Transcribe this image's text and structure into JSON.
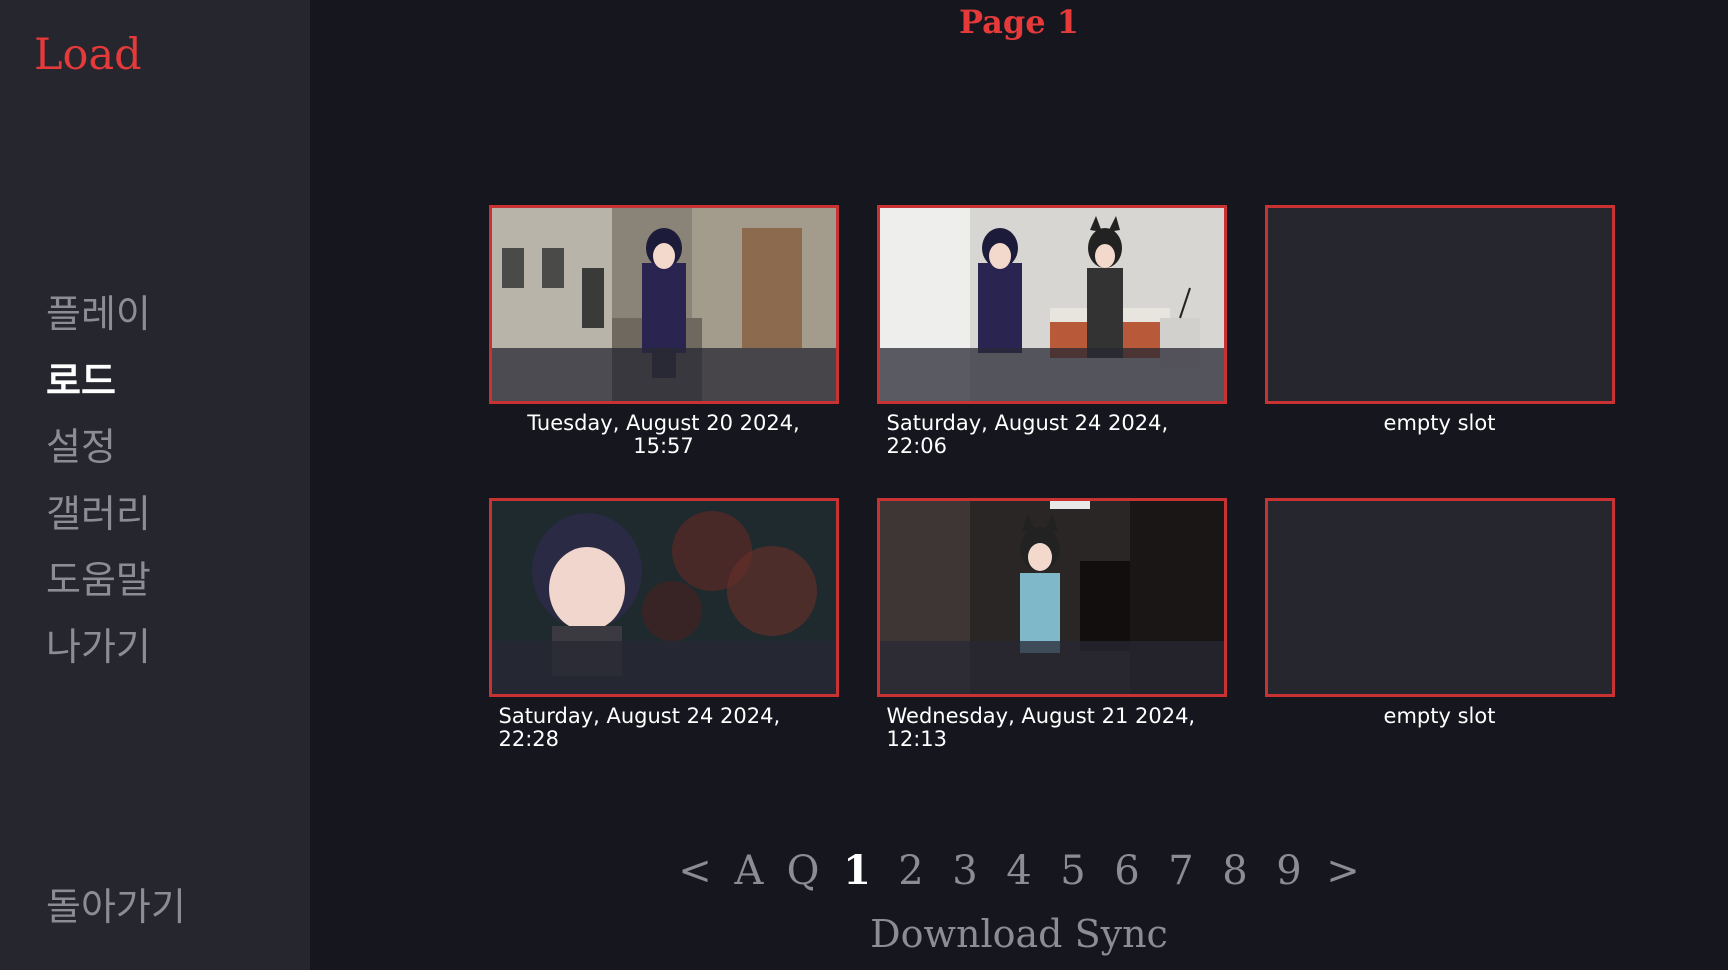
{
  "screen": {
    "title": "Load",
    "page_title": "Page 1"
  },
  "nav": {
    "items": [
      {
        "label": "플레이",
        "active": false
      },
      {
        "label": "로드",
        "active": true
      },
      {
        "label": "설정",
        "active": false
      },
      {
        "label": "갤러리",
        "active": false
      },
      {
        "label": "도움말",
        "active": false
      },
      {
        "label": "나가기",
        "active": false
      }
    ],
    "return_label": "돌아가기"
  },
  "slots": [
    {
      "label": "Tuesday, August 20 2024, 15:57",
      "filled": true
    },
    {
      "label": "Saturday, August 24 2024, 22:06",
      "filled": true
    },
    {
      "label": "empty slot",
      "filled": false
    },
    {
      "label": "Saturday, August 24 2024, 22:28",
      "filled": true
    },
    {
      "label": "Wednesday, August 21 2024, 12:13",
      "filled": true
    },
    {
      "label": "empty slot",
      "filled": false
    }
  ],
  "pager": {
    "prev": "<",
    "auto": "A",
    "quick": "Q",
    "pages": [
      "1",
      "2",
      "3",
      "4",
      "5",
      "6",
      "7",
      "8",
      "9"
    ],
    "current": "1",
    "next": ">"
  },
  "sync_label": "Download Sync",
  "colors": {
    "accent": "#e63a3a",
    "frame": "#c83232",
    "sidebar": "#26262f",
    "background": "#16161e"
  }
}
